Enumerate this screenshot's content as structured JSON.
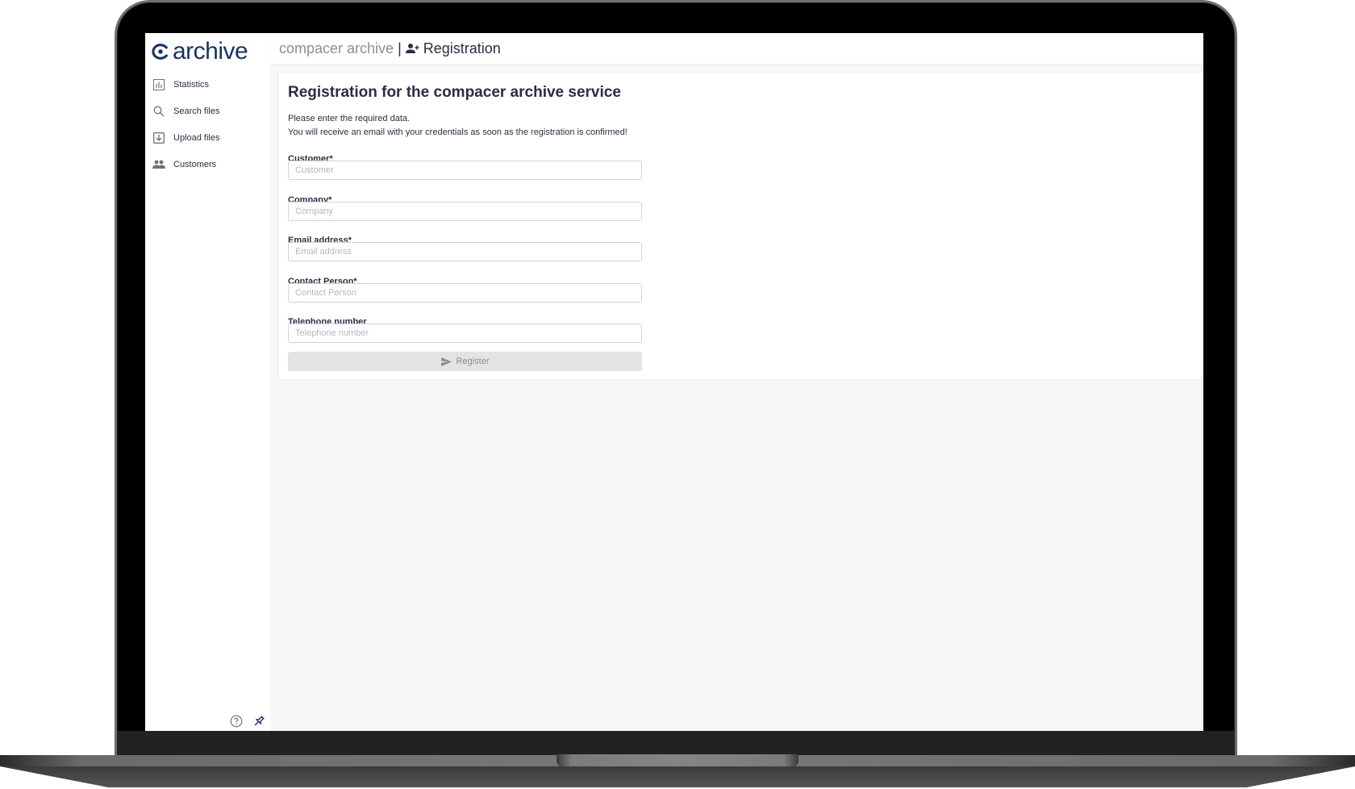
{
  "logo": {
    "text": "archive"
  },
  "sidebar": {
    "items": [
      {
        "label": "Statistics",
        "icon": "bar-chart-icon"
      },
      {
        "label": "Search files",
        "icon": "search-icon"
      },
      {
        "label": "Upload files",
        "icon": "upload-icon"
      },
      {
        "label": "Customers",
        "icon": "people-icon"
      }
    ],
    "footer": {
      "help_icon": "help-circle-icon",
      "pin_icon": "pin-icon"
    }
  },
  "header": {
    "app_name": "compacer archive",
    "separator": "|",
    "page_icon": "person-add-icon",
    "page_title": "Registration"
  },
  "form": {
    "title": "Registration for the compacer archive service",
    "description_1": "Please enter the required data.",
    "description_2": "You will receive an email with your credentials as soon as the registration is confirmed!",
    "fields": [
      {
        "label": "Customer*",
        "placeholder": "Customer",
        "value": ""
      },
      {
        "label": "Company*",
        "placeholder": "Company",
        "value": ""
      },
      {
        "label": "Email address*",
        "placeholder": "Email address",
        "value": ""
      },
      {
        "label": "Contact Person*",
        "placeholder": "Contact Person",
        "value": ""
      },
      {
        "label": "Telephone number",
        "placeholder": "Telephone number",
        "value": ""
      }
    ],
    "submit": {
      "label": "Register",
      "icon": "send-icon",
      "disabled": true
    }
  },
  "colors": {
    "brand": "#1b3360",
    "text": "#2b2d42",
    "muted": "#8a8f99",
    "background": "#f6f7f9",
    "button_disabled": "#e3e3e3"
  }
}
